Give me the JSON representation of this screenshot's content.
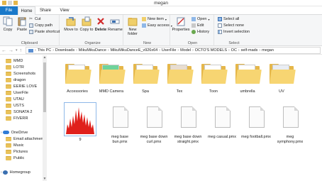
{
  "window": {
    "title": "megan"
  },
  "tabs": {
    "file": "File",
    "home": "Home",
    "share": "Share",
    "view": "View"
  },
  "ribbon": {
    "clipboard": {
      "label": "Clipboard",
      "copy": "Copy",
      "paste": "Paste",
      "cut": "Cut",
      "copy_path": "Copy path",
      "paste_shortcut": "Paste shortcut"
    },
    "organize": {
      "label": "Organize",
      "move_to": "Move to",
      "copy_to": "Copy to",
      "delete": "Delete",
      "rename": "Rename"
    },
    "new": {
      "label": "New",
      "new_folder": "New folder",
      "new_item": "New item",
      "easy_access": "Easy access"
    },
    "open": {
      "label": "Open",
      "properties": "Properties",
      "open": "Open",
      "edit": "Edit",
      "history": "History"
    },
    "select": {
      "label": "Select",
      "select_all": "Select all",
      "select_none": "Select none",
      "invert_selection": "Invert selection"
    }
  },
  "address": {
    "crumbs": [
      "This PC",
      "Downloads",
      "MikuMikuDance",
      "MikuMikuDanceE_v926x64",
      "UserFile",
      "Model",
      "OCTO'S MODELS",
      "OC",
      "self-mads",
      "megan"
    ]
  },
  "nav": {
    "items": [
      "MMD",
      "LOTR",
      "Screenshots",
      "dragon",
      "EERIE LOVE",
      "UserFile",
      "UTAU",
      "USTS",
      "SONATA 2",
      "FIVERR",
      "OneDrive",
      "Email attachments",
      "Music",
      "Pictures",
      "Public",
      "Homegroup"
    ]
  },
  "files": {
    "folders": [
      "Accessories",
      "MMD Camera",
      "Spa",
      "Tex",
      "Toon",
      "umbrella",
      "UV"
    ],
    "image_file": "9",
    "documents": [
      "meg base bun.pmx",
      "meg base down curl.pmx",
      "meg base down straight.pmx",
      "meg casual.pmx",
      "meg football.pmx",
      "meg symphony.pmx"
    ]
  },
  "colors": {
    "file_tab": "#1979ca",
    "folder": "#f7d572",
    "wave": "#e0201b"
  }
}
